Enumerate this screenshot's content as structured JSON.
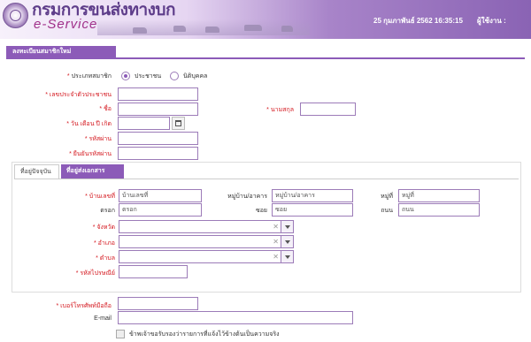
{
  "header": {
    "brand_th": "กรมการขนส่งทางบก",
    "brand_en": "e-Service",
    "datetime": "25 กุมภาพันธ์ 2562 16:35:15",
    "user_label": "ผู้ใช้งาน :"
  },
  "page_tab": "ลงทะเบียนสมาชิกใหม่",
  "form": {
    "member_type": {
      "label": "ประเภทสมาชิก",
      "options": [
        {
          "label": "ประชาชน",
          "selected": true
        },
        {
          "label": "นิติบุคคล",
          "selected": false
        }
      ]
    },
    "id_card": {
      "label": "เลขประจำตัวประชาชน",
      "value": ""
    },
    "first_name": {
      "label": "ชื่อ",
      "value": ""
    },
    "last_name": {
      "label": "นามสกุล",
      "value": ""
    },
    "birthdate": {
      "label": "วัน เดือน ปี เกิด",
      "value": ""
    },
    "password": {
      "label": "รหัสผ่าน",
      "value": ""
    },
    "confirm_password": {
      "label": "ยืนยันรหัสผ่าน",
      "value": ""
    }
  },
  "address": {
    "tabs": [
      {
        "label": "ที่อยู่ปัจจุบัน",
        "active": false
      },
      {
        "label": "ที่อยู่ส่งเอกสาร",
        "active": true
      }
    ],
    "house_no": {
      "label": "บ้านเลขที่",
      "placeholder": "บ้านเลขที่"
    },
    "village": {
      "label": "หมู่บ้าน/อาคาร",
      "placeholder": "หมู่บ้าน/อาคาร"
    },
    "moo": {
      "label": "หมู่ที่",
      "placeholder": "หมู่ที่"
    },
    "trok": {
      "label": "ตรอก",
      "placeholder": "ตรอก"
    },
    "soi": {
      "label": "ซอย",
      "placeholder": "ซอย"
    },
    "road": {
      "label": "ถนน",
      "placeholder": "ถนน"
    },
    "province": {
      "label": "จังหวัด",
      "value": ""
    },
    "district": {
      "label": "อำเภอ",
      "value": ""
    },
    "subdistrict": {
      "label": "ตำบล",
      "value": ""
    },
    "postcode": {
      "label": "รหัสไปรษณีย์",
      "value": ""
    }
  },
  "contact": {
    "mobile": {
      "label": "เบอร์โทรศัพท์มือถือ",
      "value": ""
    },
    "email": {
      "label": "E-mail",
      "value": ""
    }
  },
  "consent": {
    "label": "ข้าพเจ้าขอรับรองว่ารายการที่แจ้งไว้ข้างต้นเป็นความจริง",
    "checked": false
  },
  "required_marker": "*"
}
